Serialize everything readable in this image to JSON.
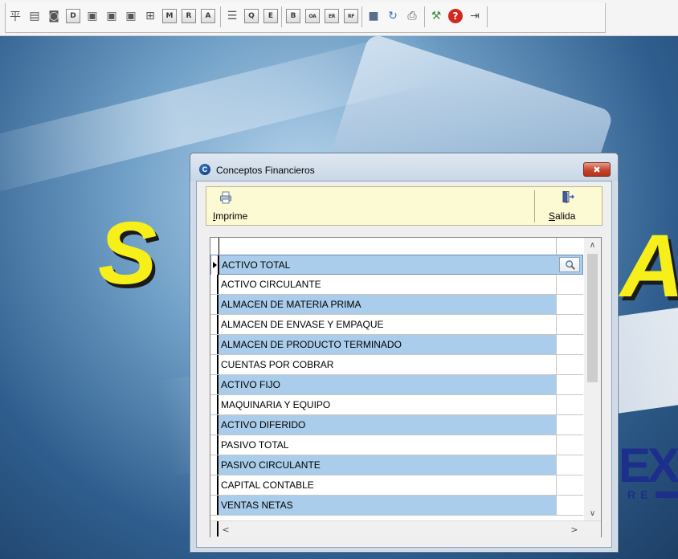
{
  "toolbar": {
    "buttons": [
      {
        "icon": "org-tree-icon",
        "text": "平"
      },
      {
        "icon": "table-icon",
        "text": "▤"
      },
      {
        "icon": "database-icon",
        "text": "◙"
      },
      {
        "icon": "letter-d-icon",
        "text": "D"
      },
      {
        "icon": "ledger-1-icon",
        "text": "▣"
      },
      {
        "icon": "ledger-2-icon",
        "text": "▣"
      },
      {
        "icon": "ledger-3-icon",
        "text": "▣"
      },
      {
        "icon": "grid-plus-icon",
        "text": "⊞"
      },
      {
        "icon": "letter-m-icon",
        "text": "M"
      },
      {
        "icon": "letter-r-icon",
        "text": "R"
      },
      {
        "icon": "letter-a-icon",
        "text": "A"
      },
      {
        "icon": "list-icon",
        "text": "☰"
      },
      {
        "icon": "letter-q-icon",
        "text": "Q"
      },
      {
        "icon": "letter-e-icon",
        "text": "E"
      },
      {
        "icon": "letter-b-icon",
        "text": "B"
      },
      {
        "icon": "letters-oa-icon",
        "text": "OA"
      },
      {
        "icon": "letters-er-icon",
        "text": "ER"
      },
      {
        "icon": "letters-rf-icon",
        "text": "RF"
      },
      {
        "icon": "save-icon",
        "text": "■"
      },
      {
        "icon": "refresh-icon",
        "text": "↻"
      },
      {
        "icon": "printer-icon",
        "text": "⎙"
      },
      {
        "icon": "tools-icon",
        "text": "⚒"
      },
      {
        "icon": "help-icon",
        "text": "?"
      },
      {
        "icon": "exit-icon",
        "text": "⇥"
      }
    ]
  },
  "background": {
    "brand_left": "S",
    "brand_right": "A",
    "brand_fragment": "EX",
    "brand_tagline": "RE"
  },
  "dialog": {
    "title": "Conceptos Financieros",
    "app_icon_letter": "C",
    "close_glyph": "✖",
    "actions": {
      "print_label_first": "I",
      "print_label_rest": "mprime",
      "exit_label_first": "S",
      "exit_label_rest": "alida"
    },
    "grid": {
      "rows": [
        "ACTIVO TOTAL",
        "ACTIVO CIRCULANTE",
        "ALMACEN DE MATERIA PRIMA",
        "ALMACEN DE ENVASE Y EMPAQUE",
        "ALMACEN DE PRODUCTO TERMINADO",
        "CUENTAS POR COBRAR",
        "ACTIVO FIJO",
        "MAQUINARIA Y EQUIPO",
        "ACTIVO DIFERIDO",
        "PASIVO TOTAL",
        "PASIVO CIRCULANTE",
        "CAPITAL CONTABLE",
        "VENTAS NETAS"
      ],
      "selected_index": 0,
      "scroll_up": "∧",
      "scroll_down": "∨",
      "scroll_left": "<",
      "scroll_right": ">"
    }
  }
}
